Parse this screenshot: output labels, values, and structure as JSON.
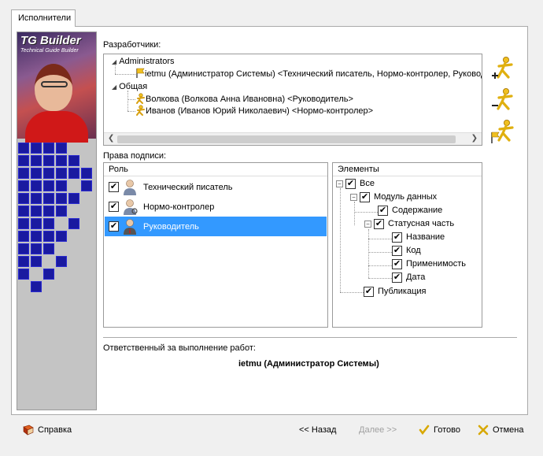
{
  "tabs": [
    {
      "label": "Исполнители"
    }
  ],
  "banner": {
    "logo": "TG Builder",
    "logo_sub": "Technical Guide Builder"
  },
  "developers": {
    "label": "Разработчики:",
    "tree": [
      {
        "group": "Administrators",
        "items": [
          "ietmu (Администратор Системы) <Технический писатель, Нормо-контролер, Руководи"
        ]
      },
      {
        "group": "Общая",
        "items": [
          "Волкова (Волкова Анна Ивановна) <Руководитель>",
          "Иванов (Иванов Юрий Николаевич) <Нормо-контролер>"
        ]
      }
    ]
  },
  "signature": {
    "label": "Права подписи:",
    "roles_header": "Роль",
    "roles": [
      {
        "label": "Технический писатель",
        "checked": true,
        "selected": false
      },
      {
        "label": "Нормо-контролер",
        "checked": true,
        "selected": false
      },
      {
        "label": "Руководитель",
        "checked": true,
        "selected": true
      }
    ],
    "elements_header": "Элементы",
    "elements": {
      "all": "Все",
      "module": "Модуль данных",
      "content": "Содержание",
      "status": "Статусная часть",
      "name": "Название",
      "code": "Код",
      "applicability": "Применимость",
      "date": "Дата",
      "publication": "Публикация"
    }
  },
  "responsible": {
    "label": "Ответственный за выполнение работ:",
    "value": "ietmu (Администратор Системы)"
  },
  "buttons": {
    "help": "Справка",
    "back": "<< Назад",
    "next": "Далее >>",
    "done": "Готово",
    "cancel": "Отмена"
  },
  "colors": {
    "selection": "#3399ff",
    "check": "#000000",
    "user_icon": "#f0c020"
  }
}
